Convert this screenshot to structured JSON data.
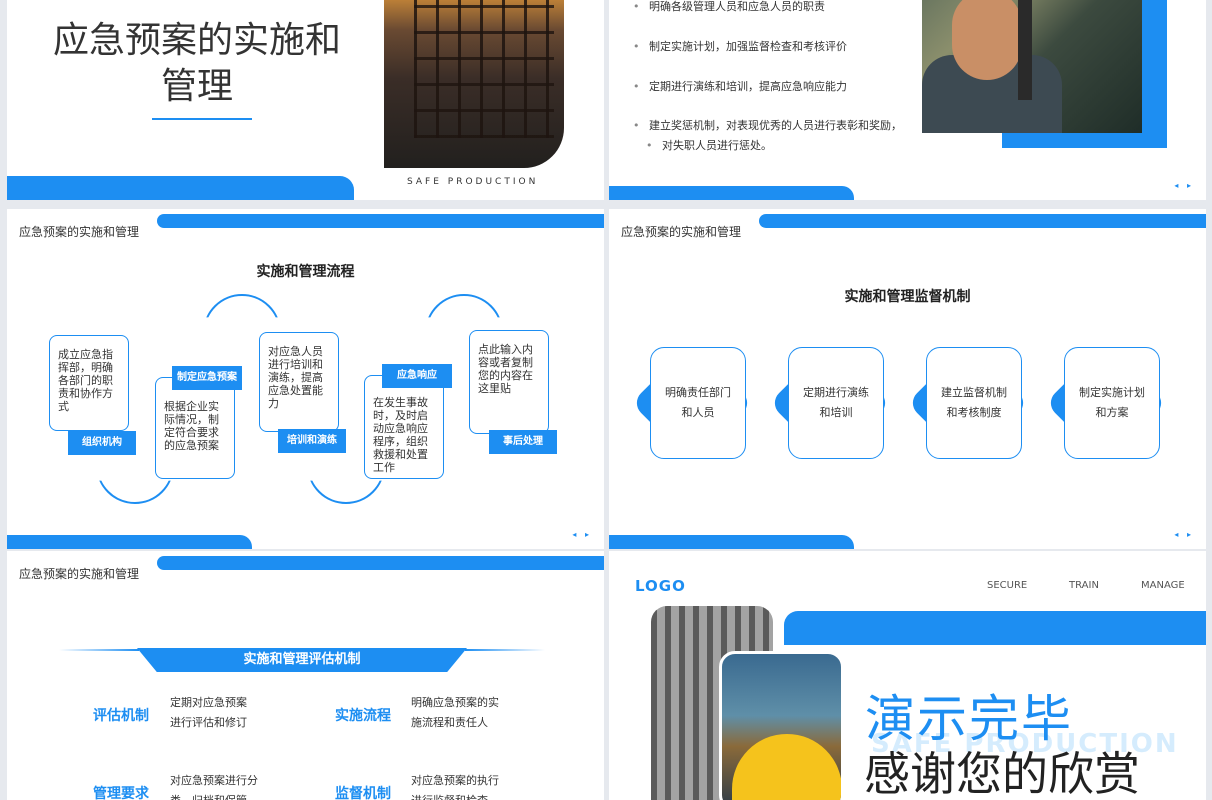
{
  "brand_color": "#1d8ef2",
  "common": {
    "header": "应急预案的实施和管理",
    "nav_arrows": "◂ ▸"
  },
  "slide1": {
    "title_line1": "应急预案的实施和",
    "title_line2": "管理",
    "subtitle": "SAFE PRODUCTION",
    "photo_icon": "construction-photo"
  },
  "slide2": {
    "bullets": [
      "明确各级管理人员和应急人员的职责",
      "制定实施计划，加强监督检查和考核评价",
      "定期进行演练和培训，提高应急响应能力",
      "建立奖惩机制，对表现优秀的人员进行表彰和奖励，",
      "对失职人员进行惩处。"
    ]
  },
  "slide3": {
    "title": "实施和管理流程",
    "steps": [
      {
        "tag": "组织机构",
        "text": "成立应急指挥部，明确各部门的职责和协作方式"
      },
      {
        "tag": "制定应急预案",
        "text": "根据企业实际情况，制定符合要求的应急预案"
      },
      {
        "tag": "培训和演练",
        "text": "对应急人员进行培训和演练，提高应急处置能力"
      },
      {
        "tag": "应急响应",
        "text": "在发生事故时，及时启动应急响应程序，组织救援和处置工作"
      },
      {
        "tag": "事后处理",
        "text": "点此输入内容或者复制您的内容在这里贴"
      }
    ]
  },
  "slide4": {
    "title": "实施和管理监督机制",
    "cards": [
      {
        "line1": "明确责任部门",
        "line2": "和人员"
      },
      {
        "line1": "定期进行演练",
        "line2": "和培训"
      },
      {
        "line1": "建立监督机制",
        "line2": "和考核制度"
      },
      {
        "line1": "制定实施计划",
        "line2": "和方案"
      }
    ]
  },
  "slide5": {
    "title": "实施和管理评估机制",
    "items": [
      {
        "head": "评估机制",
        "line1": "定期对应急预案",
        "line2": "进行评估和修订"
      },
      {
        "head": "实施流程",
        "line1": "明确应急预案的实",
        "line2": "施流程和责任人"
      },
      {
        "head": "管理要求",
        "line1": "对应急预案进行分",
        "line2": "类、归档和保管"
      },
      {
        "head": "监督机制",
        "line1": "对应急预案的执行",
        "line2": "进行监督和检查"
      }
    ]
  },
  "slide6": {
    "logo": "LOGO",
    "nav": [
      "SECURE",
      "TRAIN",
      "MANAGE"
    ],
    "ghost": "SAFE PRODUCTION",
    "line1": "演示完毕",
    "line2": "感谢您的欣赏"
  }
}
